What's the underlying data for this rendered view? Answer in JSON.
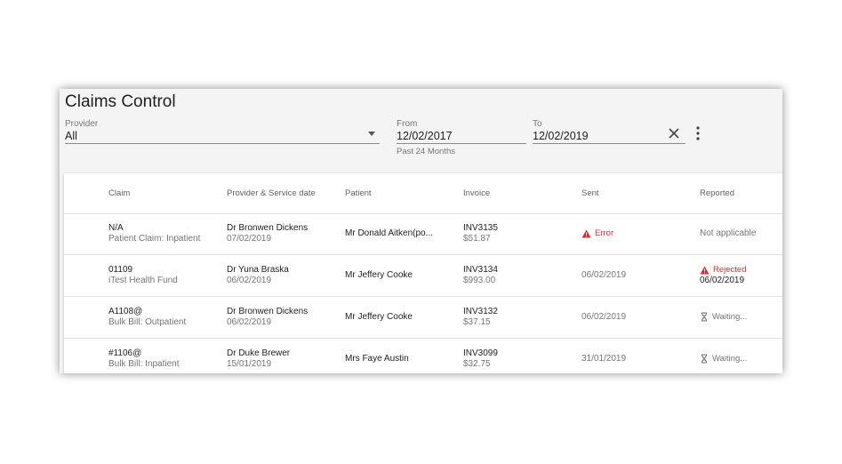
{
  "page": {
    "title": "Claims Control"
  },
  "filters": {
    "provider": {
      "label": "Provider",
      "value": "All"
    },
    "from": {
      "label": "From",
      "value": "12/02/2017"
    },
    "to": {
      "label": "To",
      "value": "12/02/2019"
    },
    "range_hint": "Past 24 Months"
  },
  "table": {
    "headers": [
      "Claim",
      "Provider & Service date",
      "Patient",
      "Invoice",
      "Sent",
      "Reported"
    ],
    "rows": [
      {
        "claim": "N/A",
        "claim_type": "Patient Claim: Inpatient",
        "provider": "Dr Bronwen Dickens",
        "service_date": "07/02/2019",
        "patient": "Mr Donald Aitken(po...",
        "invoice": "INV3135",
        "amount": "$51.87",
        "sent": "Error",
        "sent_icon": "warning-icon",
        "reported": "Not applicable"
      },
      {
        "claim": "01109",
        "claim_type": "iTest Health Fund",
        "provider": "Dr Yuna Braska",
        "service_date": "06/02/2019",
        "patient": "Mr Jeffery Cooke",
        "invoice": "INV3134",
        "amount": "$993.00",
        "sent": "06/02/2019",
        "reported": "Rejected",
        "reported_date": "06/02/2019",
        "reported_icon": "warning-icon"
      },
      {
        "claim": "A1108@",
        "claim_type": "Bulk Bill: Outpatient",
        "provider": "Dr Bronwen Dickens",
        "service_date": "06/02/2019",
        "patient": "Mr Jeffery Cooke",
        "invoice": "INV3132",
        "amount": "$37.15",
        "sent": "06/02/2019",
        "reported": "Waiting...",
        "reported_icon": "hourglass-icon"
      },
      {
        "claim": "#1106@",
        "claim_type": "Bulk Bill: Inpatient",
        "provider": "Dr Duke Brewer",
        "service_date": "15/01/2019",
        "patient": "Mrs Faye Austin",
        "invoice": "INV3099",
        "amount": "$32.75",
        "sent": "31/01/2019",
        "reported": "Waiting...",
        "reported_icon": "hourglass-icon"
      }
    ]
  },
  "colors": {
    "error": "#d32f2f",
    "panel_bg": "#f4f4f4"
  }
}
